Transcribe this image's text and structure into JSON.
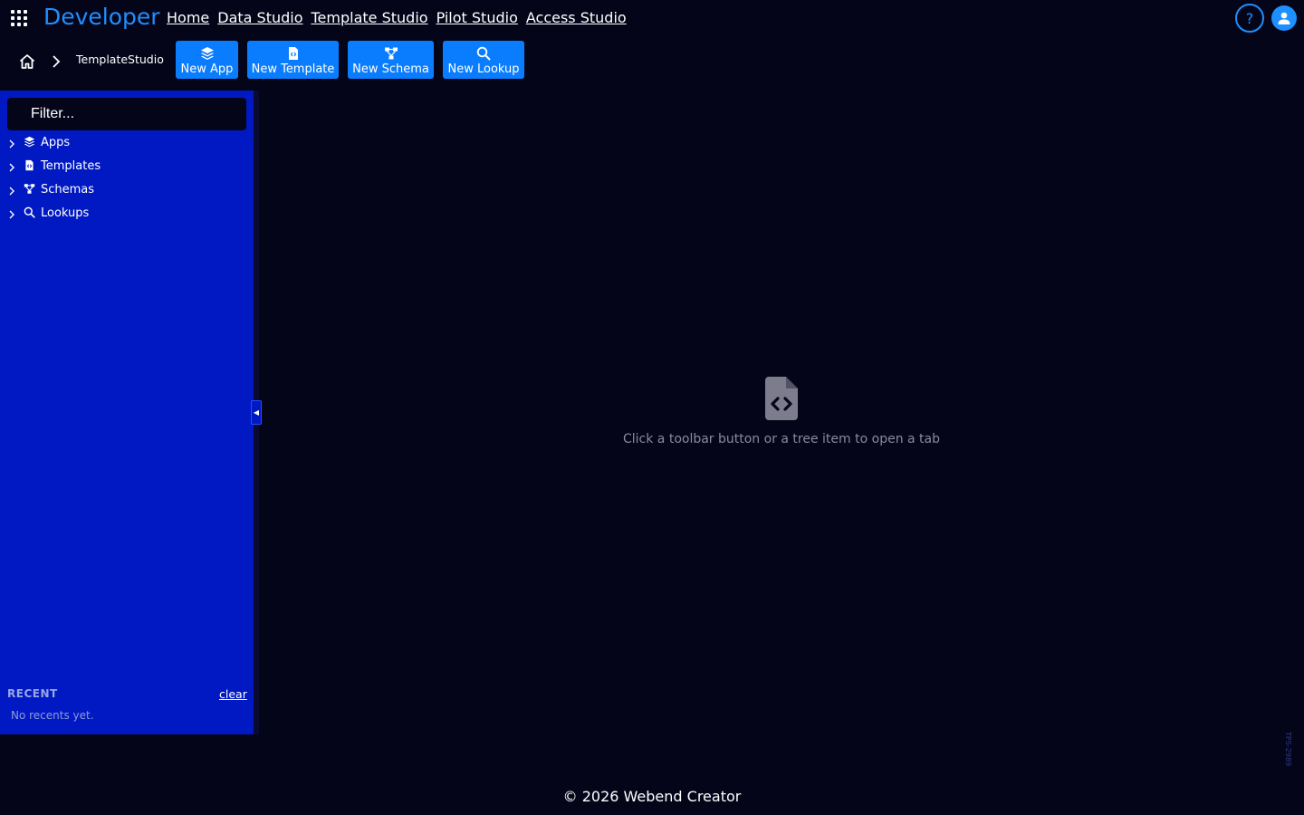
{
  "header": {
    "brand": "Developer",
    "nav": [
      "Home",
      "Data Studio",
      "Template Studio",
      "Pilot Studio",
      "Access Studio"
    ],
    "help_label": "?"
  },
  "breadcrumb": {
    "current": "TemplateStudio"
  },
  "toolbar": {
    "new_app": "New App",
    "new_template": "New Template",
    "new_schema": "New Schema",
    "new_lookup": "New Lookup"
  },
  "sidebar": {
    "filter_placeholder": "Filter...",
    "items": [
      {
        "label": "Apps",
        "icon": "layers-icon"
      },
      {
        "label": "Templates",
        "icon": "file-code-icon"
      },
      {
        "label": "Schemas",
        "icon": "schema-icon"
      },
      {
        "label": "Lookups",
        "icon": "search-icon"
      }
    ],
    "recent": {
      "label": "RECENT",
      "clear": "clear",
      "empty": "No recents yet."
    },
    "collapse_glyph": "◀"
  },
  "main": {
    "empty_message": "Click a toolbar button or a tree item to open a tab"
  },
  "footer": {
    "text": "© 2026 Webend Creator"
  },
  "build_tag": "TPS-2989",
  "colors": {
    "background": "#05051a",
    "sidebar": "#0019c2",
    "accent": "#0a7dff",
    "brand": "#1e8fff"
  }
}
